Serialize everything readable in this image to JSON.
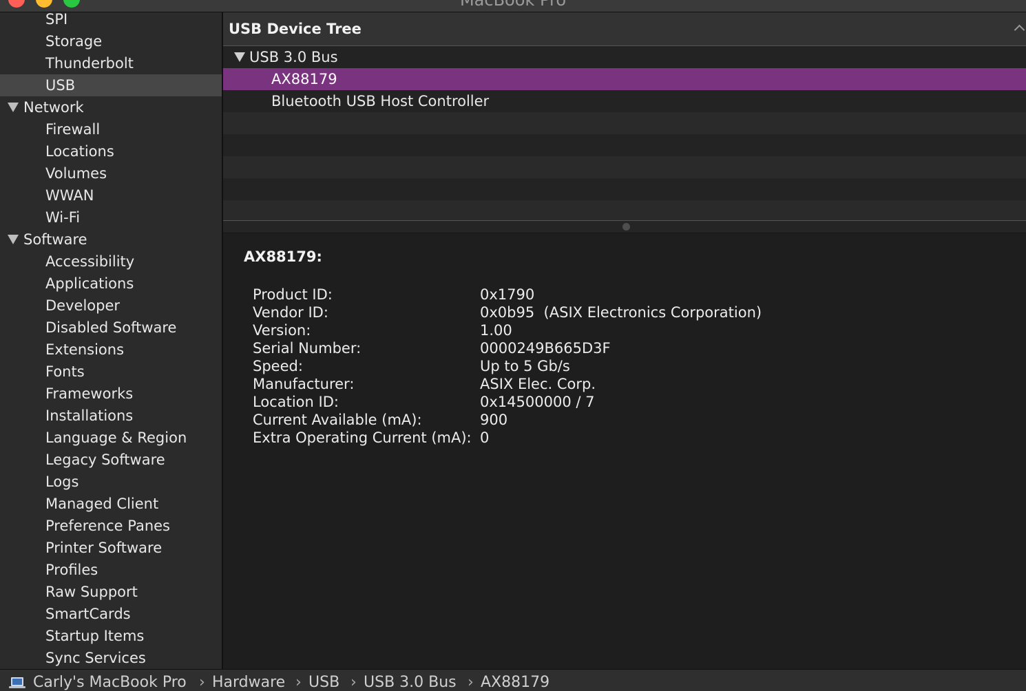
{
  "window": {
    "title": "MacBook Pro"
  },
  "sidebar": {
    "items": [
      {
        "label": "SPI",
        "kind": "child"
      },
      {
        "label": "Storage",
        "kind": "child"
      },
      {
        "label": "Thunderbolt",
        "kind": "child"
      },
      {
        "label": "USB",
        "kind": "child",
        "selected": true
      },
      {
        "label": "Network",
        "kind": "group"
      },
      {
        "label": "Firewall",
        "kind": "child"
      },
      {
        "label": "Locations",
        "kind": "child"
      },
      {
        "label": "Volumes",
        "kind": "child"
      },
      {
        "label": "WWAN",
        "kind": "child"
      },
      {
        "label": "Wi-Fi",
        "kind": "child"
      },
      {
        "label": "Software",
        "kind": "group"
      },
      {
        "label": "Accessibility",
        "kind": "child"
      },
      {
        "label": "Applications",
        "kind": "child"
      },
      {
        "label": "Developer",
        "kind": "child"
      },
      {
        "label": "Disabled Software",
        "kind": "child"
      },
      {
        "label": "Extensions",
        "kind": "child"
      },
      {
        "label": "Fonts",
        "kind": "child"
      },
      {
        "label": "Frameworks",
        "kind": "child"
      },
      {
        "label": "Installations",
        "kind": "child"
      },
      {
        "label": "Language & Region",
        "kind": "child"
      },
      {
        "label": "Legacy Software",
        "kind": "child"
      },
      {
        "label": "Logs",
        "kind": "child"
      },
      {
        "label": "Managed Client",
        "kind": "child"
      },
      {
        "label": "Preference Panes",
        "kind": "child"
      },
      {
        "label": "Printer Software",
        "kind": "child"
      },
      {
        "label": "Profiles",
        "kind": "child"
      },
      {
        "label": "Raw Support",
        "kind": "child"
      },
      {
        "label": "SmartCards",
        "kind": "child"
      },
      {
        "label": "Startup Items",
        "kind": "child"
      },
      {
        "label": "Sync Services",
        "kind": "child"
      }
    ]
  },
  "tree": {
    "header": "USB Device Tree",
    "bus": "USB 3.0 Bus",
    "devices": [
      "AX88179",
      "Bluetooth USB Host Controller"
    ],
    "selected_color": "#7a347f"
  },
  "detail": {
    "title": "AX88179:",
    "properties": [
      {
        "label": "Product ID:",
        "value": "0x1790"
      },
      {
        "label": "Vendor ID:",
        "value": "0x0b95  (ASIX Electronics Corporation)"
      },
      {
        "label": "Version:",
        "value": "1.00"
      },
      {
        "label": "Serial Number:",
        "value": "0000249B665D3F"
      },
      {
        "label": "Speed:",
        "value": "Up to 5 Gb/s"
      },
      {
        "label": "Manufacturer:",
        "value": "ASIX Elec. Corp."
      },
      {
        "label": "Location ID:",
        "value": "0x14500000 / 7"
      },
      {
        "label": "Current Available (mA):",
        "value": "900"
      },
      {
        "label": "Extra Operating Current (mA):",
        "value": "0"
      }
    ]
  },
  "pathbar": {
    "icon": "laptop-icon",
    "crumbs": [
      "Carly's MacBook Pro",
      "Hardware",
      "USB",
      "USB 3.0 Bus",
      "AX88179"
    ]
  }
}
